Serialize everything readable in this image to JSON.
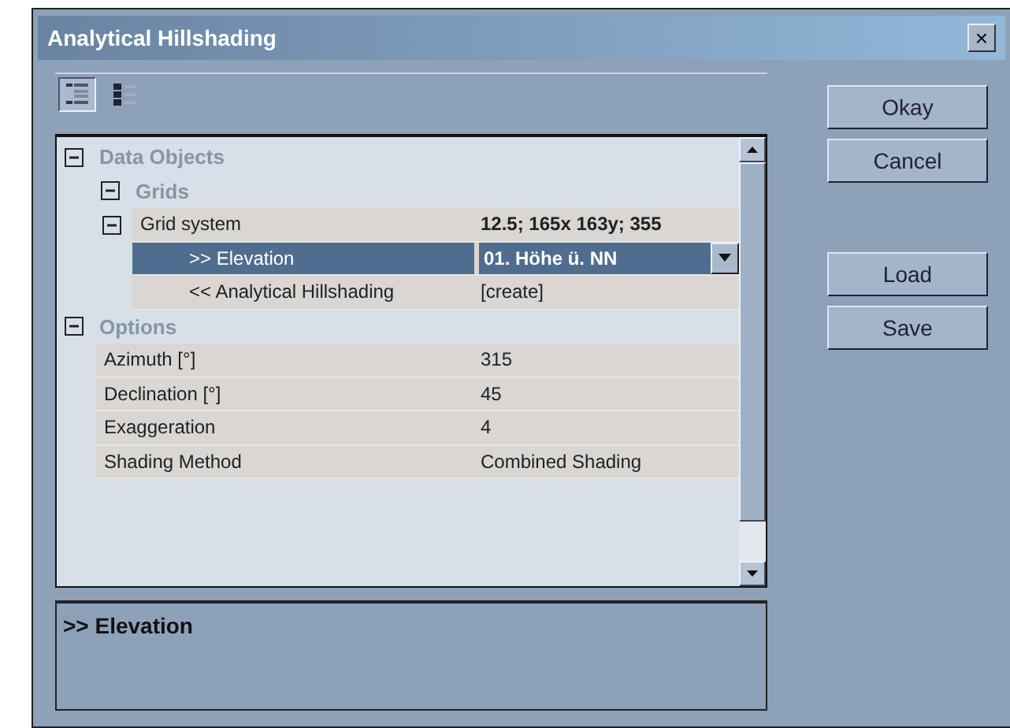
{
  "window": {
    "title": "Analytical Hillshading",
    "close": "×"
  },
  "toolbar": [
    {
      "kind": "categorized",
      "selected": true
    },
    {
      "kind": "alphabetical",
      "selected": false
    }
  ],
  "tree": [
    {
      "kind": "category",
      "label": "Data Objects",
      "expanded": true,
      "children": [
        {
          "kind": "category",
          "label": "Grids",
          "expanded": true,
          "children": [
            {
              "kind": "property",
              "label": "Grid system",
              "value": "12.5; 165x 163y; 355",
              "emphasized": true,
              "expanded": true,
              "selected": false,
              "children": [
                {
                  "kind": "choice",
                  "label": ">> Elevation",
                  "value": "01. Höhe ü. NN",
                  "selected": true
                },
                {
                  "kind": "property",
                  "label": "<< Analytical Hillshading",
                  "value": "[create]",
                  "emphasized": false,
                  "selected": false
                }
              ]
            }
          ]
        }
      ]
    },
    {
      "kind": "category",
      "label": "Options",
      "expanded": true,
      "children": [
        {
          "kind": "property",
          "label": "Azimuth [°]",
          "value": "315",
          "emphasized": false,
          "selected": false
        },
        {
          "kind": "property",
          "label": "Declination [°]",
          "value": "45",
          "emphasized": false,
          "selected": false
        },
        {
          "kind": "property",
          "label": "Exaggeration",
          "value": "4",
          "emphasized": false,
          "selected": false
        },
        {
          "kind": "property",
          "label": "Shading Method",
          "value": "Combined Shading",
          "emphasized": false,
          "selected": false
        }
      ]
    }
  ],
  "help_text": ">> Elevation",
  "buttons": {
    "dialog": [
      "Okay",
      "Cancel"
    ],
    "file": [
      "Load",
      "Save"
    ]
  }
}
